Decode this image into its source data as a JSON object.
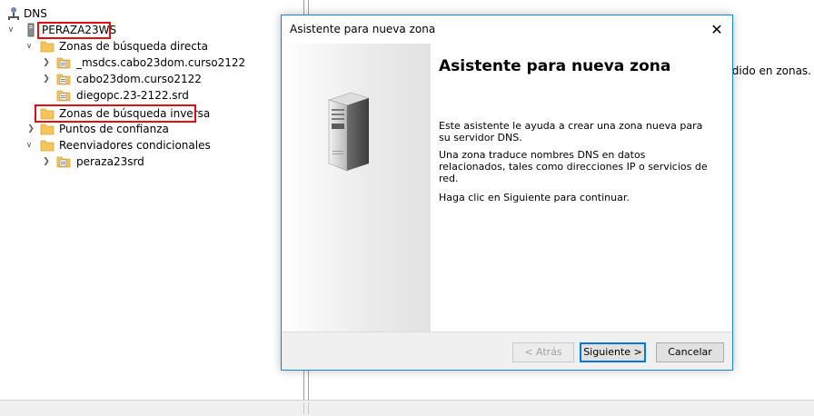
{
  "tree": {
    "root_label": "DNS",
    "server_label": "PERAZA23WS",
    "items": [
      {
        "label": "Zonas de búsqueda directa"
      },
      {
        "label": "_msdcs.cabo23dom.curso2122"
      },
      {
        "label": "cabo23dom.curso2122"
      },
      {
        "label": "diegopc.23-2122.srd"
      },
      {
        "label": "Zonas de búsqueda inversa"
      },
      {
        "label": "Puntos de confianza"
      },
      {
        "label": "Reenviadores condicionales"
      },
      {
        "label": "peraza23srd"
      }
    ]
  },
  "right_pane": {
    "visible_text": "vidido en zonas."
  },
  "dialog": {
    "title": "Asistente para nueva zona",
    "heading": "Asistente para nueva zona",
    "para1": "Este asistente le ayuda a crear una zona nueva para su servidor DNS.",
    "para2": "Una zona traduce nombres DNS en datos relacionados, tales como direcciones IP o servicios de red.",
    "para3": "Haga clic en Siguiente para continuar.",
    "back_label": "< Atrás",
    "next_label": "Siguiente >",
    "cancel_label": "Cancelar"
  },
  "colors": {
    "highlight": "#e01010",
    "folder": "#f4c55b",
    "accent": "#0078d7"
  }
}
